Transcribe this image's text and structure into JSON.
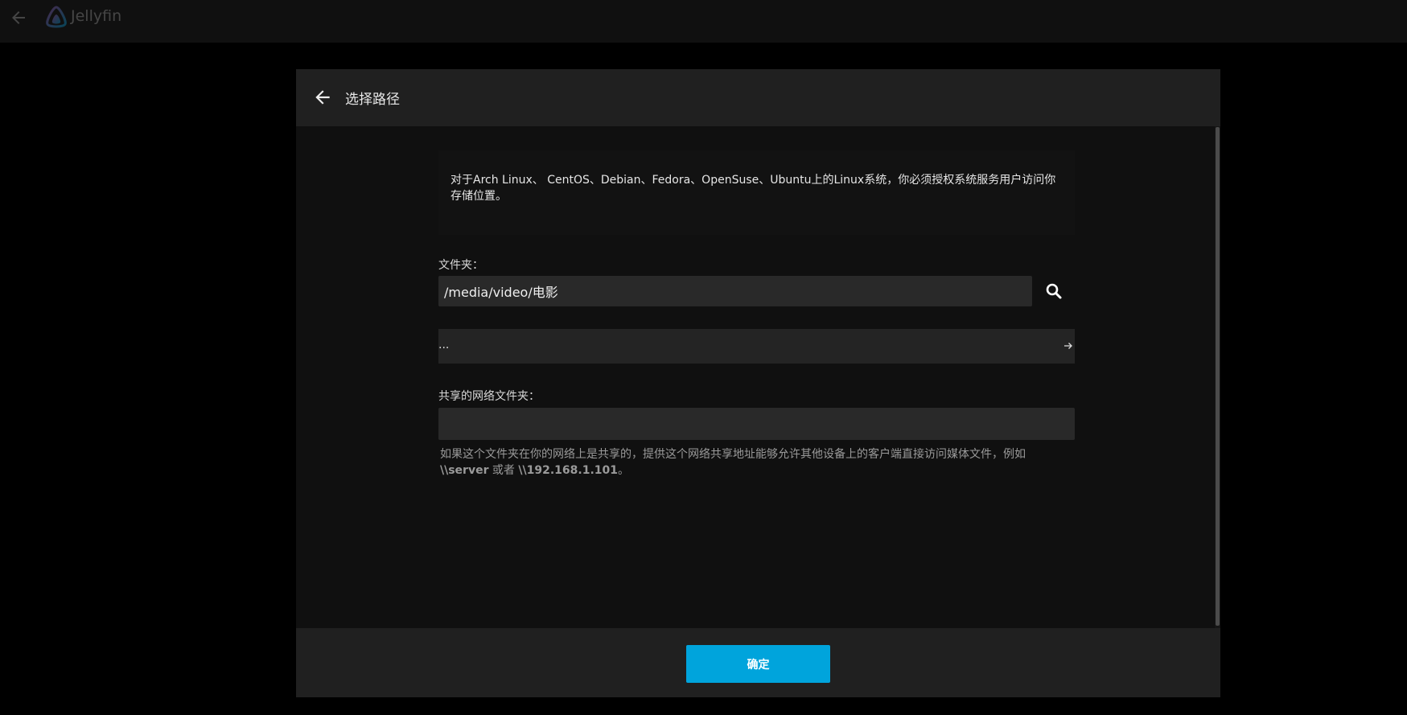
{
  "topbar": {
    "back_icon": "arrow-left-icon",
    "logo_icon": "jellyfin-logo",
    "brand": "Jellyfin"
  },
  "dialog": {
    "title": "选择路径",
    "back_icon": "arrow-left-icon",
    "info_text": "对于Arch Linux、 CentOS、Debian、Fedora、OpenSuse、Ubuntu上的Linux系统，你必须授权系统服务用户访问你存储位置。",
    "folder_label": "文件夹：",
    "folder_value": "/media/video/电影",
    "search_icon": "search-icon",
    "directory_list": [
      {
        "name": "...",
        "icon": "arrow-right-icon"
      }
    ],
    "network_share_label": "共享的网络文件夹：",
    "network_share_value": "",
    "network_share_help_prefix": "如果这个文件夹在你的网络上是共享的，提供这个网络共享地址能够允许其他设备上的客户端直接访问媒体文件，例如",
    "network_share_example_1": "\\\\server",
    "network_share_help_middle": " 或者 ",
    "network_share_example_2": "\\\\192.168.1.101",
    "network_share_help_suffix": "。",
    "ok_button": "确定"
  },
  "colors": {
    "accent": "#00a4dc",
    "background": "#101010",
    "header": "#202020"
  }
}
